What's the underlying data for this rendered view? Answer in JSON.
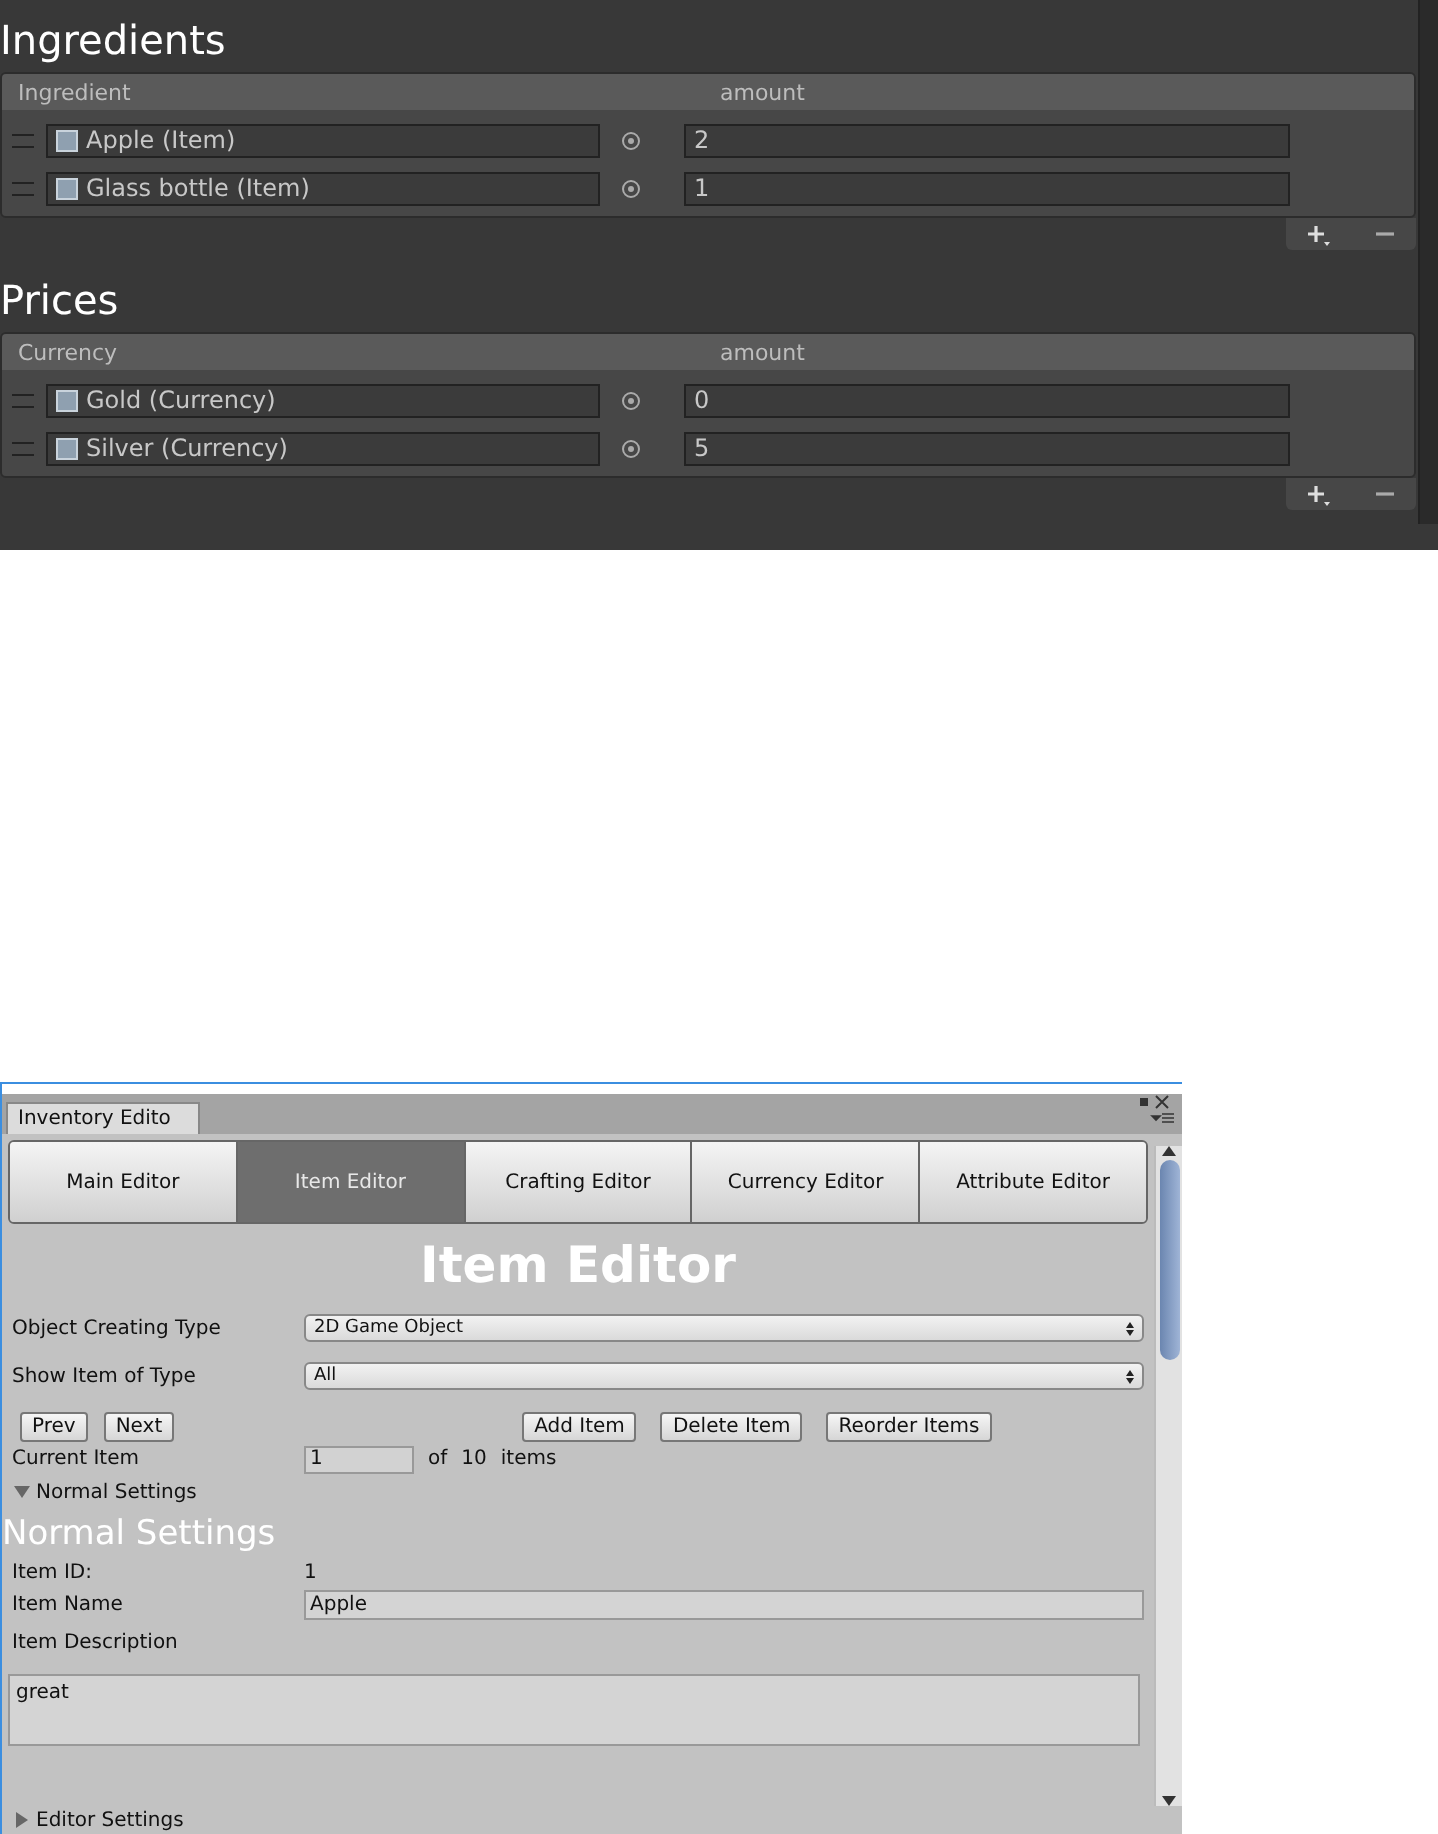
{
  "dark_panel": {
    "sections": [
      {
        "title": "Ingredients",
        "columns": [
          "Ingredient",
          "amount"
        ],
        "rows": [
          {
            "object": "Apple (Item)",
            "amount": "2"
          },
          {
            "object": "Glass bottle (Item)",
            "amount": "1"
          }
        ]
      },
      {
        "title": "Prices",
        "columns": [
          "Currency",
          "amount"
        ],
        "rows": [
          {
            "object": "Gold (Currency)",
            "amount": "0"
          },
          {
            "object": "Silver (Currency)",
            "amount": "5"
          }
        ]
      }
    ]
  },
  "editor_window": {
    "tab": "Inventory Edito",
    "toolbar": [
      {
        "label": "Main Editor",
        "selected": false
      },
      {
        "label": "Item Editor",
        "selected": true
      },
      {
        "label": "Crafting Editor",
        "selected": false
      },
      {
        "label": "Currency Editor",
        "selected": false
      },
      {
        "label": "Attribute Editor",
        "selected": false
      }
    ],
    "heading": "Item Editor",
    "dropdowns": [
      {
        "label": "Object Creating Type",
        "value": "2D Game Object"
      },
      {
        "label": "Show Item of Type",
        "value": "All"
      }
    ],
    "nav_buttons": [
      "Prev",
      "Next"
    ],
    "action_buttons": [
      "Add Item",
      "Delete Item",
      "Reorder Items"
    ],
    "current_item": {
      "label": "Current Item",
      "value": "1",
      "of": "of",
      "total": "10",
      "unit": "items"
    },
    "normal_foldout": {
      "label": "Normal Settings",
      "expanded": true
    },
    "section_heading": "Normal Settings",
    "item_id": {
      "label": "Item ID:",
      "value": "1"
    },
    "item_name": {
      "label": "Item Name",
      "value": "Apple"
    },
    "item_description": {
      "label": "Item Description",
      "value": "great"
    },
    "editor_foldout": {
      "label": "Editor Settings",
      "expanded": false
    }
  }
}
